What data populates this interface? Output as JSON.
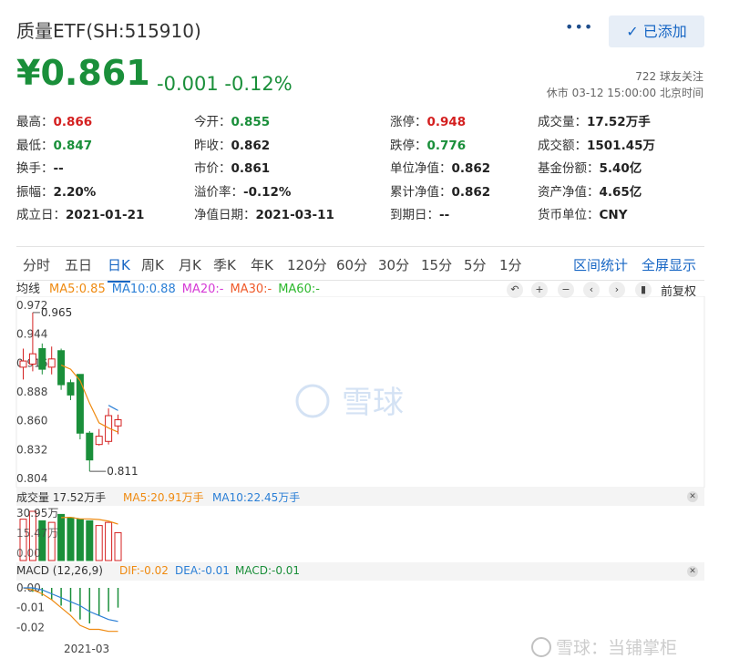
{
  "header": {
    "title": "质量ETF(SH:515910)",
    "more_label": "•••",
    "added_label": "已添加",
    "check_icon": "check-icon"
  },
  "quote": {
    "price": "¥0.861",
    "change": "-0.001",
    "change_pct": "-0.12%",
    "followers": "722 球友关注",
    "status": "休市 03-12 15:00:00 北京时间"
  },
  "stats": [
    [
      {
        "k": "最高：",
        "v": "0.866",
        "c": "red"
      },
      {
        "k": "今开：",
        "v": "0.855",
        "c": "green"
      },
      {
        "k": "涨停：",
        "v": "0.948",
        "c": "red"
      },
      {
        "k": "成交量：",
        "v": "17.52万手",
        "c": "dark"
      }
    ],
    [
      {
        "k": "最低：",
        "v": "0.847",
        "c": "green"
      },
      {
        "k": "昨收：",
        "v": "0.862",
        "c": "dark"
      },
      {
        "k": "跌停：",
        "v": "0.776",
        "c": "green"
      },
      {
        "k": "成交额：",
        "v": "1501.45万",
        "c": "dark"
      }
    ],
    [
      {
        "k": "换手：",
        "v": "--",
        "c": "dark"
      },
      {
        "k": "市价：",
        "v": "0.861",
        "c": "dark"
      },
      {
        "k": "单位净值：",
        "v": "0.862",
        "c": "dark"
      },
      {
        "k": "基金份额：",
        "v": "5.40亿",
        "c": "dark"
      }
    ],
    [
      {
        "k": "振幅：",
        "v": "2.20%",
        "c": "dark"
      },
      {
        "k": "溢价率：",
        "v": "-0.12%",
        "c": "dark"
      },
      {
        "k": "累计净值：",
        "v": "0.862",
        "c": "dark"
      },
      {
        "k": "资产净值：",
        "v": "4.65亿",
        "c": "dark"
      }
    ],
    [
      {
        "k": "成立日：",
        "v": "2021-01-21",
        "c": "dark"
      },
      {
        "k": "净值日期：",
        "v": "2021-03-11",
        "c": "dark"
      },
      {
        "k": "到期日：",
        "v": "--",
        "c": "dark"
      },
      {
        "k": "货币单位：",
        "v": "CNY",
        "c": "dark"
      }
    ]
  ],
  "tabs": [
    "分时",
    "五日",
    "日K",
    "周K",
    "月K",
    "季K",
    "年K",
    "120分",
    "60分",
    "30分",
    "15分",
    "5分",
    "1分"
  ],
  "active_tab": "日K",
  "tab_links": [
    "区间统计",
    "全屏显示"
  ],
  "ma_legend": {
    "label": "均线",
    "items": [
      {
        "text": "MA5:0.85",
        "color": "#ef8a10"
      },
      {
        "text": "MA10:0.88",
        "color": "#2b7fd6"
      },
      {
        "text": "MA20:-",
        "color": "#d63bd6"
      },
      {
        "text": "MA30:-",
        "color": "#ef5a2a"
      },
      {
        "text": "MA60:-",
        "color": "#2db82d"
      }
    ]
  },
  "chart_controls": [
    "undo-icon",
    "zoom-in-icon",
    "zoom-out-icon",
    "chevron-left-icon",
    "chevron-right-icon",
    "bar-icon"
  ],
  "chart_controls_text": "前复权",
  "volume_legend": {
    "label": "成交量 17.52万手",
    "items": [
      {
        "text": "MA5:20.91万手",
        "color": "#ef8a10"
      },
      {
        "text": "MA10:22.45万手",
        "color": "#2b7fd6"
      }
    ]
  },
  "macd_legend": {
    "label": "MACD (12,26,9)",
    "items": [
      {
        "text": "DIF:-0.02",
        "color": "#ef8a10"
      },
      {
        "text": "DEA:-0.01",
        "color": "#2b7fd6"
      },
      {
        "text": "MACD:-0.01",
        "color": "#1a8f3a"
      }
    ]
  },
  "watermark": "雪球",
  "footer_watermark": "雪球：当铺掌柜",
  "chart_data": [
    {
      "type": "candlestick",
      "yticks": [
        "0.972",
        "0.944",
        "0.916",
        "0.888",
        "0.860",
        "0.832",
        "0.804"
      ],
      "ylim": [
        0.804,
        0.972
      ],
      "max_label": "0.965",
      "min_label": "0.811",
      "candles": [
        {
          "o": 0.912,
          "c": 0.918,
          "h": 0.93,
          "l": 0.9
        },
        {
          "o": 0.915,
          "c": 0.925,
          "h": 0.965,
          "l": 0.908
        },
        {
          "o": 0.93,
          "c": 0.91,
          "h": 0.935,
          "l": 0.905
        },
        {
          "o": 0.912,
          "c": 0.92,
          "h": 0.932,
          "l": 0.905
        },
        {
          "o": 0.928,
          "c": 0.895,
          "h": 0.93,
          "l": 0.89
        },
        {
          "o": 0.897,
          "c": 0.885,
          "h": 0.9,
          "l": 0.88
        },
        {
          "o": 0.905,
          "c": 0.848,
          "h": 0.905,
          "l": 0.842
        },
        {
          "o": 0.848,
          "c": 0.822,
          "h": 0.85,
          "l": 0.811
        },
        {
          "o": 0.837,
          "c": 0.845,
          "h": 0.852,
          "l": 0.836
        },
        {
          "o": 0.84,
          "c": 0.865,
          "h": 0.872,
          "l": 0.837
        },
        {
          "o": 0.855,
          "c": 0.861,
          "h": 0.866,
          "l": 0.847
        }
      ],
      "ma5": [
        null,
        null,
        null,
        null,
        0.914,
        0.91,
        0.899,
        0.877,
        0.858,
        0.853,
        0.849
      ],
      "ma10": [
        null,
        null,
        null,
        null,
        null,
        null,
        null,
        null,
        null,
        0.875,
        0.87
      ]
    },
    {
      "type": "bar",
      "label": "成交量",
      "ytick": "30.95万",
      "overlapped_ticks": [
        "15.47万",
        "0.00"
      ],
      "values": [
        26.0,
        30.95,
        25.0,
        24.0,
        29.0,
        27.0,
        26.0,
        25.0,
        22.0,
        24.0,
        17.52
      ],
      "up": [
        true,
        true,
        false,
        true,
        false,
        false,
        false,
        false,
        true,
        true,
        true
      ],
      "ma5": [
        null,
        null,
        null,
        null,
        27.0,
        27.2,
        26.2,
        26.2,
        25.8,
        24.8,
        22.9
      ]
    },
    {
      "type": "macd",
      "x_label": "2021-03",
      "yticks": [
        "0.00",
        "-0.01",
        "-0.02"
      ],
      "ylim": [
        -0.024,
        0.0
      ],
      "hist": [
        0.0,
        -0.002,
        -0.004,
        -0.006,
        -0.009,
        -0.012,
        -0.016,
        -0.018,
        -0.014,
        -0.012,
        -0.01
      ],
      "dif": [
        0.0,
        -0.001,
        -0.003,
        -0.006,
        -0.01,
        -0.014,
        -0.019,
        -0.021,
        -0.021,
        -0.022,
        -0.022
      ],
      "dea": [
        0.0,
        0.0,
        -0.001,
        -0.003,
        -0.005,
        -0.007,
        -0.009,
        -0.012,
        -0.014,
        -0.016,
        -0.017
      ]
    }
  ]
}
